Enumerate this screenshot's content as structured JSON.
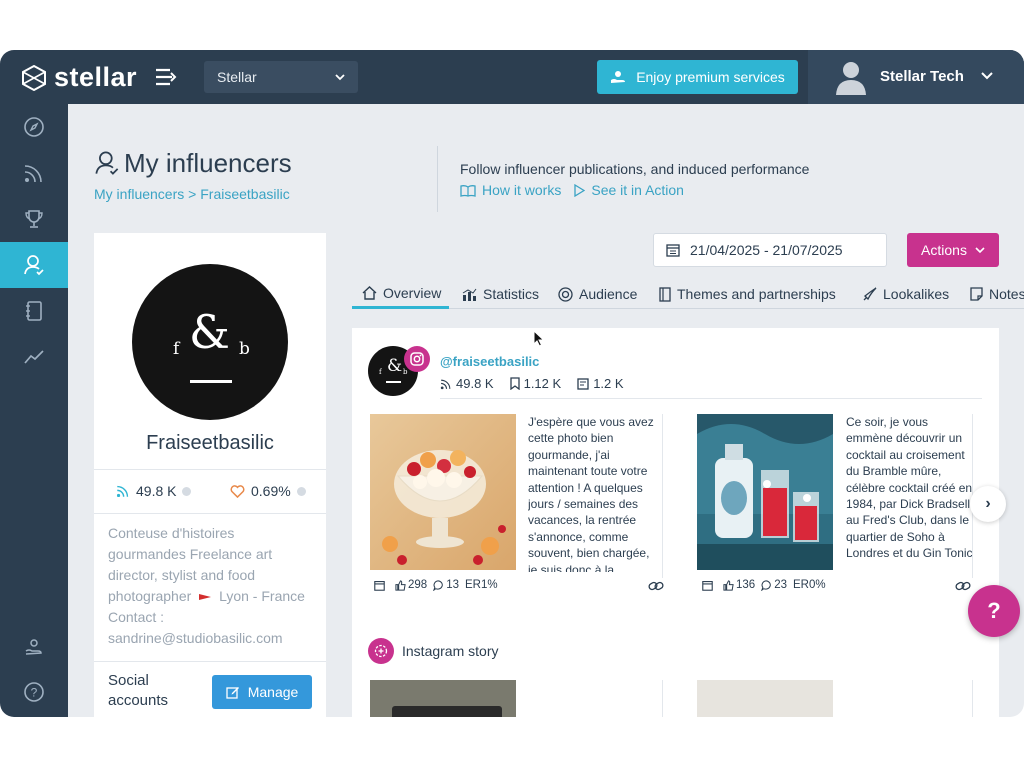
{
  "app": {
    "brand": "stellar",
    "workspace": "Stellar",
    "premium_label": "Enjoy premium services",
    "user_name": "Stellar Tech"
  },
  "sidebar": {
    "items": [
      {
        "icon": "compass-icon",
        "active": false
      },
      {
        "icon": "rss-icon",
        "active": false
      },
      {
        "icon": "trophy-icon",
        "active": false
      },
      {
        "icon": "influencer-icon",
        "active": true
      },
      {
        "icon": "notebook-icon",
        "active": false
      },
      {
        "icon": "trend-icon",
        "active": false
      }
    ],
    "bottom": [
      {
        "icon": "premium-hand-icon"
      },
      {
        "icon": "help-circle-icon"
      }
    ]
  },
  "header": {
    "title": "My influencers",
    "breadcrumb": [
      "My influencers",
      "Fraiseetbasilic"
    ],
    "breadcrumb_sep": ">",
    "description": "Follow influencer publications, and induced performance",
    "links": [
      "How it works",
      "See it in Action"
    ]
  },
  "profile": {
    "name": "Fraiseetbasilic",
    "logo_text": {
      "left": "f",
      "amp": "&",
      "right": "b"
    },
    "followers": "49.8 K",
    "engagement": "0.69%",
    "bio": "Conteuse d'histoires gourmandes Freelance art director, stylist and food photographer",
    "location": "Lyon - France",
    "contact": "Contact : sandrine@studiobasilic.com",
    "social_label": "Social accounts",
    "manage_label": "Manage"
  },
  "toolbar": {
    "date_range": "21/04/2025 - 21/07/2025",
    "actions_label": "Actions"
  },
  "tabs": [
    {
      "label": "Overview",
      "icon": "home-icon",
      "active": true
    },
    {
      "label": "Statistics",
      "icon": "bar-chart-icon",
      "active": false
    },
    {
      "label": "Audience",
      "icon": "target-icon",
      "active": false
    },
    {
      "label": "Themes and partnerships",
      "icon": "book-icon",
      "active": false
    },
    {
      "label": "Lookalikes",
      "icon": "rocket-icon",
      "active": false
    },
    {
      "label": "Notes",
      "icon": "note-icon",
      "active": false
    }
  ],
  "account": {
    "handle": "@fraiseetbasilic",
    "network": "instagram",
    "followers": "49.8 K",
    "saves": "1.12 K",
    "posts": "1.2 K"
  },
  "posts": [
    {
      "text": "J'espère que vous avez cette photo bien gourmande, j'ai maintenant toute votre attention ! A quelques jours / semaines des vacances, la rentrée s'annonce, comme souvent, bien chargée, je suis donc à la",
      "likes": "298",
      "comments": "13",
      "er": "ER1%"
    },
    {
      "text": "Ce soir, je vous emmène découvrir un cocktail au croisement du Bramble mûre, célèbre cocktail créé en 1984, par Dick Bradsell au Fred's Club, dans le quartier de Soho à Londres et du Gin Tonic",
      "likes": "136",
      "comments": "23",
      "er": "ER0%"
    }
  ],
  "story": {
    "label": "Instagram story"
  },
  "next_label": "›",
  "help_label": "?",
  "colors": {
    "topbar": "#2c3e50",
    "accent": "#2fb5d3",
    "brand_pink": "#c8328e",
    "manage_blue": "#3498db",
    "link": "#3aa3c4"
  }
}
